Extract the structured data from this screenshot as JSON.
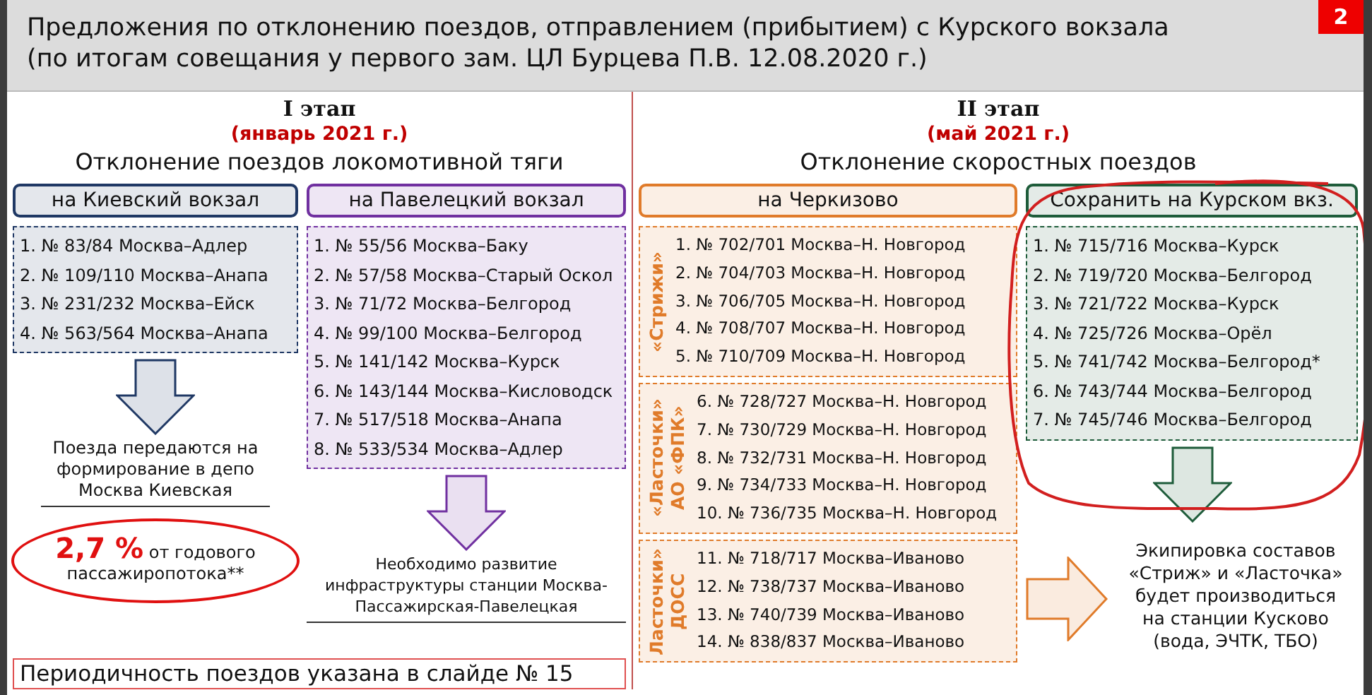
{
  "slide_number": "2",
  "title_lines": [
    "Предложения по отклонению поездов, отправлением (прибытием) с Курского вокзала",
    "(по итогам совещания у первого зам. ЦЛ Бурцева П.В. 12.08.2020 г.)"
  ],
  "stages": [
    {
      "heading": "I этап",
      "period": "(январь 2021 г.)",
      "subtitle": "Отклонение поездов локомотивной тяги",
      "columns": [
        {
          "header": "на Киевский вокзал",
          "color": "#1f3864",
          "groups": [
            {
              "items": [
                "1.   № 83/84 Москва–Адлер",
                "2. № 109/110 Москва–Анапа",
                "3. № 231/232 Москва–Ейск",
                "4. № 563/564 Москва–Анапа"
              ]
            }
          ],
          "note": "Поезда передаются на формирование в депо Москва Киевская",
          "highlight": {
            "value": "2,7 %",
            "text": "от годового пассажиропотока**"
          }
        },
        {
          "header": "на Павелецкий вокзал",
          "color": "#7030a0",
          "groups": [
            {
              "items": [
                "1. № 55/56 Москва–Баку",
                "2. № 57/58 Москва–Старый Оскол",
                "3. № 71/72 Москва–Белгород",
                "4. № 99/100 Москва–Белгород",
                "5. № 141/142 Москва–Курск",
                "6. № 143/144 Москва–Кисловодск",
                "7. № 517/518 Москва–Анапа",
                "8. № 533/534 Москва–Адлер"
              ]
            }
          ],
          "note": "Необходимо развитие инфраструктуры станции Москва-Пассажирская-Павелецкая"
        }
      ],
      "footer": "Периодичность поездов указана в слайде № 15"
    },
    {
      "heading": "II этап",
      "period": "(май 2021 г.)",
      "subtitle": "Отклонение скоростных поездов",
      "columns": [
        {
          "header": "на Черкизово",
          "color": "#e07b2a",
          "groups": [
            {
              "label_lines": [
                "«Стрижи»"
              ],
              "items": [
                "1. № 702/701 Москва–Н. Новгород",
                "2. № 704/703 Москва–Н. Новгород",
                "3. № 706/705 Москва–Н. Новгород",
                "4. № 708/707 Москва–Н. Новгород",
                "5. № 710/709 Москва–Н. Новгород"
              ]
            },
            {
              "label_lines": [
                "«Ласточки»",
                "АО «ФПК»"
              ],
              "items": [
                "6. № 728/727 Москва–Н. Новгород",
                "7. № 730/729 Москва–Н. Новгород",
                "8. № 732/731 Москва–Н. Новгород",
                "9. № 734/733 Москва–Н. Новгород",
                "10. № 736/735 Москва–Н. Новгород"
              ]
            },
            {
              "label_lines": [
                "Ласточки»",
                "ДОСС"
              ],
              "items": [
                "11. № 718/717 Москва–Иваново",
                "12. № 738/737 Москва–Иваново",
                "13. № 740/739 Москва–Иваново",
                "14. № 838/837 Москва–Иваново"
              ]
            }
          ]
        },
        {
          "header": "Сохранить на Курском вкз.",
          "color": "#1e5c3a",
          "groups": [
            {
              "items": [
                "1. № 715/716 Москва–Курск",
                "2. № 719/720 Москва–Белгород",
                "3. № 721/722 Москва–Курск",
                "4. № 725/726 Москва–Орёл",
                "5. № 741/742 Москва–Белгород*",
                "6. № 743/744 Москва–Белгород",
                "7. № 745/746 Москва–Белгород"
              ]
            }
          ],
          "side_note": "Экипировка составов «Стриж» и «Ласточка» будет производиться на станции Кусково (вода, ЭЧТК, ТБО)"
        }
      ]
    }
  ]
}
